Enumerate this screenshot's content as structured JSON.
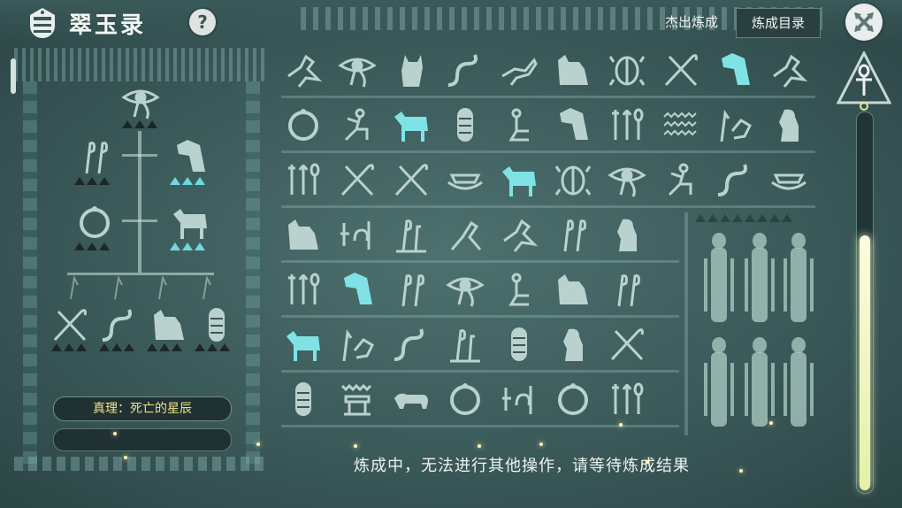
{
  "header": {
    "title": "翠玉录",
    "help_label": "?",
    "outstanding_link": "杰出炼成",
    "catalog_button": "炼成目录"
  },
  "left_panel": {
    "truth_label": "真理：死亡的星辰",
    "tree_nodes": [
      {
        "icon": "eye-of-horus-glyph",
        "marks": [
          "dark",
          "dark",
          "dark"
        ]
      },
      {
        "icon": "reed-pair-glyph",
        "marks": [
          "dark",
          "dark",
          "dark"
        ]
      },
      {
        "icon": "jackal-head-glyph",
        "marks": [
          "cyan",
          "cyan",
          "cyan"
        ]
      },
      {
        "icon": "ring-glyph",
        "marks": [
          "dark",
          "dark",
          "dark"
        ]
      },
      {
        "icon": "bull-glyph",
        "marks": [
          "cyan",
          "cyan",
          "cyan"
        ]
      },
      {
        "icon": "crook-flail-glyph",
        "marks": [
          "dark",
          "dark",
          "dark"
        ]
      },
      {
        "icon": "serpent-glyph",
        "marks": [
          "dark",
          "dark",
          "dark"
        ]
      },
      {
        "icon": "anubis-glyph",
        "marks": [
          "dark",
          "dark",
          "dark"
        ]
      },
      {
        "icon": "mummy-glyph",
        "marks": [
          "dark",
          "dark",
          "dark"
        ]
      }
    ]
  },
  "grid": {
    "rows": [
      [
        "bird",
        "eye",
        "cat",
        "serpent",
        "ibis",
        "anubis",
        "scarab",
        "crook",
        "jackal-head-hl",
        "bird"
      ],
      [
        "ring",
        "seated-figure",
        "bull-hl",
        "mummy",
        "kneeling",
        "jackal-head",
        "tools",
        "water",
        "reed-bird",
        "baboon"
      ],
      [
        "tools",
        "crook",
        "crook",
        "boat",
        "bull-hl",
        "scarab",
        "eye",
        "seated-figure",
        "serpent",
        "boat"
      ],
      [
        "anubis",
        "symbol",
        "reed",
        "heron",
        "bird",
        "reed-pair",
        "baboon"
      ],
      [
        "tools",
        "jackal-head-hl",
        "reed-pair",
        "eye",
        "kneeling",
        "anubis",
        "reed-pair"
      ],
      [
        "bull-hl",
        "reed-bird",
        "serpent",
        "reed",
        "mummy",
        "baboon",
        "crook"
      ],
      [
        "mummy",
        "altar",
        "lion",
        "ring",
        "symbol",
        "ring",
        "tools"
      ]
    ],
    "highlight_color": "#7fe3e6",
    "glyph_color": "#b9d2cd"
  },
  "status_text": "炼成中，无法进行其他操作，请等待炼成结果",
  "meter": {
    "level": 0.68,
    "top_icon": "ankh-icon",
    "ring_icon": "ring-icon"
  }
}
